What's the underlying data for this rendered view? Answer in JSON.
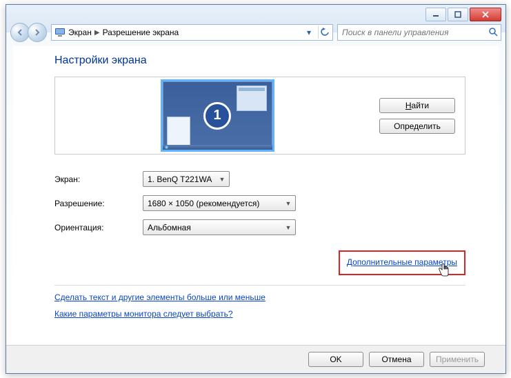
{
  "breadcrumb": {
    "item1": "Экран",
    "item2": "Разрешение экрана"
  },
  "search": {
    "placeholder": "Поиск в панели управления"
  },
  "title": "Настройки экрана",
  "monitor_number": "1",
  "buttons": {
    "find": "Найти",
    "find_key": "Н",
    "identify": "Определить",
    "ok": "OK",
    "cancel": "Отмена",
    "apply": "Применить"
  },
  "labels": {
    "display": "Экран:",
    "resolution": "Разрешение:",
    "orientation": "Ориентация:"
  },
  "values": {
    "display": "1. BenQ T221WA",
    "resolution": "1680 × 1050 (рекомендуется)",
    "orientation": "Альбомная"
  },
  "links": {
    "advanced": "Дополнительные параметры",
    "textsize": "Сделать текст и другие элементы больше или меньше",
    "whichsettings": "Какие параметры монитора следует выбрать?"
  }
}
